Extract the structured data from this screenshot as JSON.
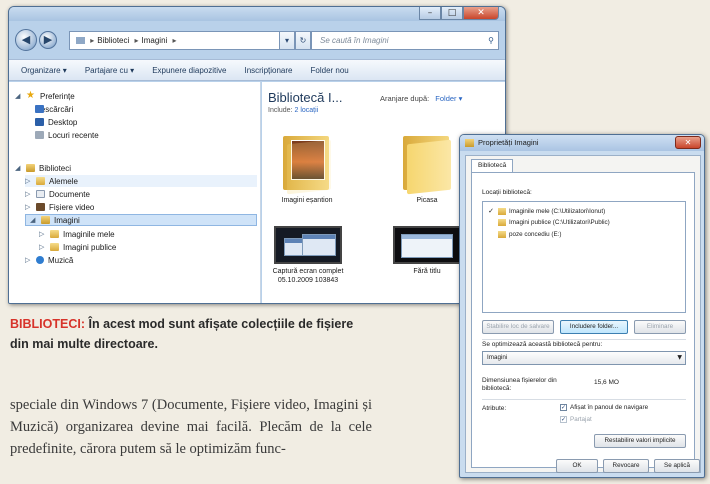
{
  "explorer": {
    "address": {
      "root": "Biblioteci",
      "current": "Imagini"
    },
    "search_placeholder": "Se caută în Imagini",
    "toolbar": [
      "Organizare ▾",
      "Partajare cu ▾",
      "Expunere diapozitive",
      "Inscripționare",
      "Folder nou"
    ],
    "nav": {
      "favorites_label": "Preferințe",
      "favorites": [
        "Descărcări",
        "Desktop",
        "Locuri recente"
      ],
      "libraries_label": "Biblioteci",
      "libraries": [
        "Alemele",
        "Documente",
        "Fișiere video",
        "Imagini"
      ],
      "images_children": [
        "Imaginile mele",
        "Imagini publice"
      ],
      "music": "Muzică"
    },
    "content": {
      "title": "Bibliotecă I...",
      "includes_prefix": "Include:",
      "includes_link": "2 locații",
      "arrange_label": "Aranjare după:",
      "arrange_value": "Folder ▾",
      "items": [
        "Imagini eșantion",
        "Picasa",
        "Captură ecran complet 05.10.2009 103843",
        "Fără titlu"
      ]
    }
  },
  "caption": {
    "lead": "BIBLIOTECI:",
    "text": "În acest mod sunt afișate colecțiile de fișiere din mai multe directoare."
  },
  "body_text": "speciale din Windows 7 (Documente, Fișiere video, Imagini și Muzică) organizarea devine mai facilă. Plecăm de la cele predefinite, cărora putem să le optimizăm func-",
  "dialog": {
    "title": "Proprietăți Imagini",
    "tab": "Bibliotecă",
    "locations_label": "Locații bibliotecă:",
    "locations": [
      {
        "checked": true,
        "name": "Imaginile mele (C:\\Utilizatori\\Ionut)"
      },
      {
        "checked": false,
        "name": "Imagini publice (C:\\Utilizatori\\Public)"
      },
      {
        "checked": false,
        "name": "poze concediu (E:)"
      }
    ],
    "btn_set_save": "Stabilire loc de salvare",
    "btn_include": "Includere folder...",
    "btn_remove": "Eliminare",
    "optimize_label": "Se optimizează această bibliotecă pentru:",
    "optimize_value": "Imagini",
    "size_label": "Dimensiunea fișierelor din bibliotecă:",
    "size_value": "15,6 MO",
    "attributes_label": "Atribute:",
    "attr_nav": "Afișat în panoul de navigare",
    "attr_shared": "Partajat",
    "btn_restore": "Restabilire valori implicite",
    "btn_ok": "OK",
    "btn_cancel": "Revocare",
    "btn_apply": "Se aplică"
  }
}
